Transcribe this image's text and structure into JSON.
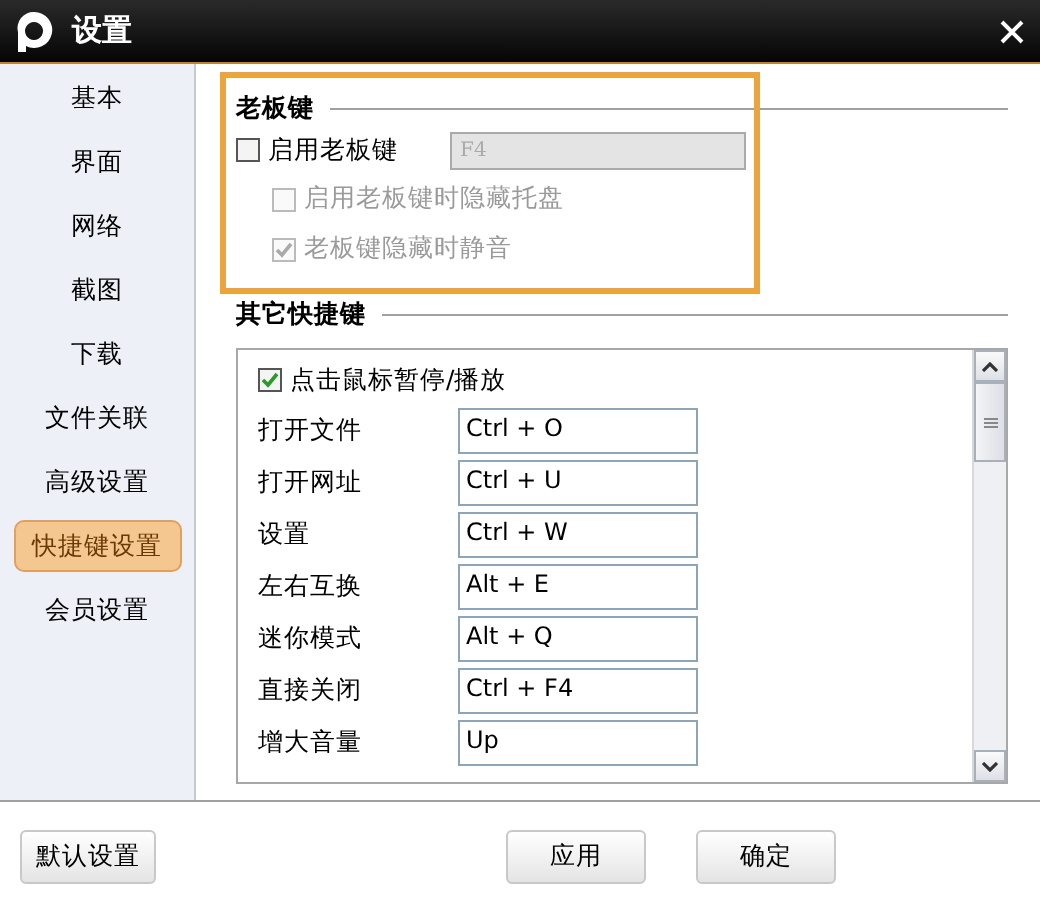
{
  "window": {
    "title": "设置"
  },
  "sidebar": {
    "items": [
      {
        "label": "基本",
        "selected": false
      },
      {
        "label": "界面",
        "selected": false
      },
      {
        "label": "网络",
        "selected": false
      },
      {
        "label": "截图",
        "selected": false
      },
      {
        "label": "下载",
        "selected": false
      },
      {
        "label": "文件关联",
        "selected": false
      },
      {
        "label": "高级设置",
        "selected": false
      },
      {
        "label": "快捷键设置",
        "selected": true
      },
      {
        "label": "会员设置",
        "selected": false
      }
    ]
  },
  "boss_key": {
    "heading": "老板键",
    "enable": {
      "label": "启用老板键",
      "checked": false
    },
    "key_field": {
      "value": "F4",
      "disabled": true
    },
    "options": [
      {
        "label": "启用老板键时隐藏托盘",
        "checked": false,
        "disabled": true
      },
      {
        "label": "老板键隐藏时静音",
        "checked": true,
        "disabled": true
      }
    ]
  },
  "other_hotkeys": {
    "heading": "其它快捷键",
    "pause_on_click": {
      "label": "点击鼠标暂停/播放",
      "checked": true
    },
    "rows": [
      {
        "label": "打开文件",
        "value": "Ctrl + O"
      },
      {
        "label": "打开网址",
        "value": "Ctrl + U"
      },
      {
        "label": "设置",
        "value": "Ctrl + W"
      },
      {
        "label": "左右互换",
        "value": "Alt + E"
      },
      {
        "label": "迷你模式",
        "value": "Alt + Q"
      },
      {
        "label": "直接关闭",
        "value": "Ctrl + F4"
      },
      {
        "label": "增大音量",
        "value": "Up"
      }
    ]
  },
  "buttons": [
    {
      "label": "默认设置"
    },
    {
      "label": "应用"
    },
    {
      "label": "确定"
    }
  ]
}
